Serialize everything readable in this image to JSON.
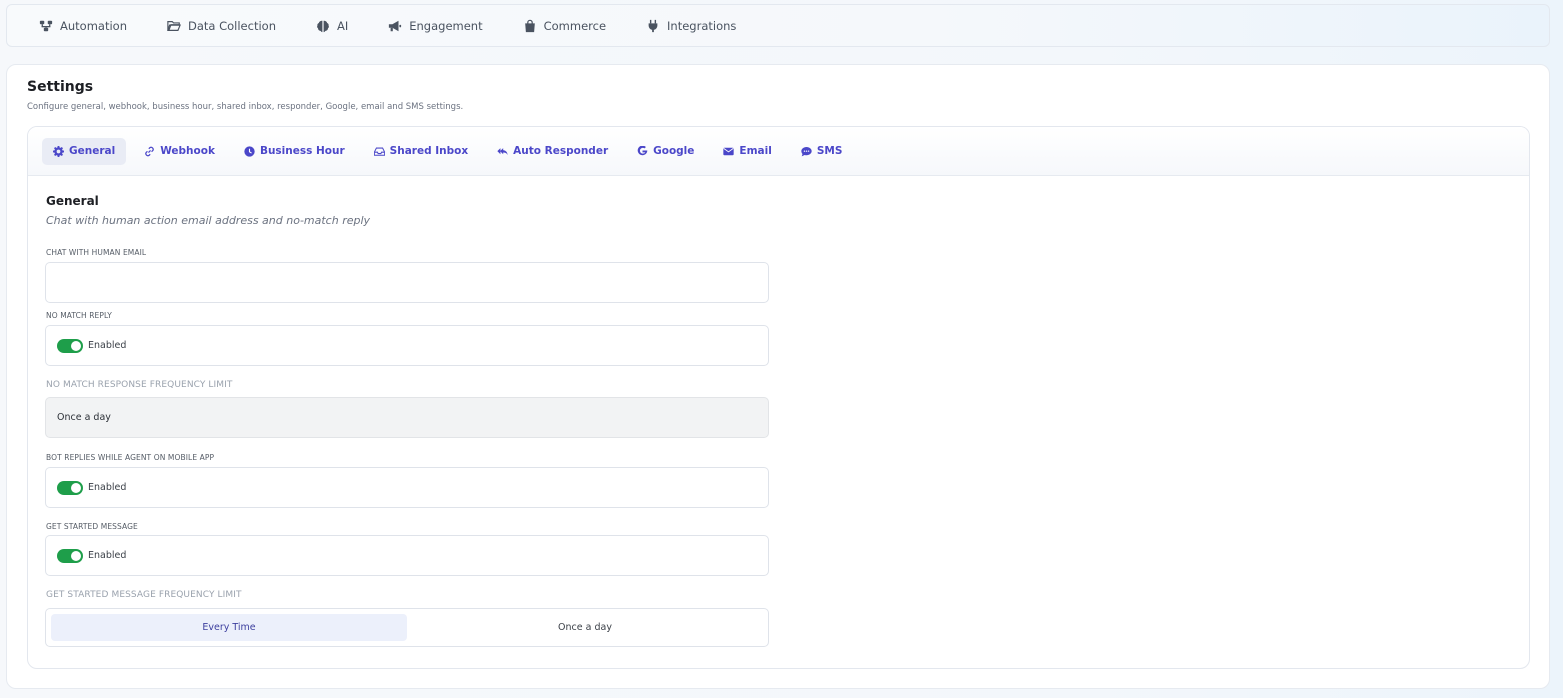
{
  "topnav": {
    "items": [
      {
        "label": "Automation",
        "icon": "sitemap-icon"
      },
      {
        "label": "Data Collection",
        "icon": "folder-open-icon"
      },
      {
        "label": "AI",
        "icon": "brain-icon"
      },
      {
        "label": "Engagement",
        "icon": "bullhorn-icon"
      },
      {
        "label": "Commerce",
        "icon": "shopping-bag-icon"
      },
      {
        "label": "Integrations",
        "icon": "plug-icon"
      }
    ]
  },
  "page": {
    "title": "Settings",
    "subtitle": "Configure general, webhook, business hour, shared inbox, responder, Google, email and SMS settings."
  },
  "tabs": [
    {
      "label": "General",
      "icon": "gear-icon",
      "active": true
    },
    {
      "label": "Webhook",
      "icon": "link-icon",
      "active": false
    },
    {
      "label": "Business Hour",
      "icon": "clock-icon",
      "active": false
    },
    {
      "label": "Shared Inbox",
      "icon": "inbox-icon",
      "active": false
    },
    {
      "label": "Auto Responder",
      "icon": "reply-all-icon",
      "active": false
    },
    {
      "label": "Google",
      "icon": "google-icon",
      "active": false
    },
    {
      "label": "Email",
      "icon": "envelope-icon",
      "active": false
    },
    {
      "label": "SMS",
      "icon": "comment-icon",
      "active": false
    }
  ],
  "general": {
    "title": "General",
    "description": "Chat with human action email address and no-match reply",
    "chat_email": {
      "label": "CHAT WITH HUMAN EMAIL",
      "value": ""
    },
    "no_match_reply": {
      "label": "NO MATCH REPLY",
      "toggle_label": "Enabled",
      "enabled": true
    },
    "no_match_frequency": {
      "label": "NO MATCH RESPONSE FREQUENCY LIMIT",
      "value": "Once a day"
    },
    "bot_replies_mobile": {
      "label": "BOT REPLIES WHILE AGENT ON MOBILE APP",
      "toggle_label": "Enabled",
      "enabled": true
    },
    "get_started_message": {
      "label": "GET STARTED MESSAGE",
      "toggle_label": "Enabled",
      "enabled": true
    },
    "get_started_frequency": {
      "label": "GET STARTED MESSAGE FREQUENCY LIMIT",
      "options": [
        "Every Time",
        "Once a day"
      ],
      "selected": "Every Time"
    }
  },
  "colors": {
    "accent": "#4b47c9",
    "toggle_on": "#1e9e4a",
    "active_tab_bg": "#e9ecf5"
  }
}
